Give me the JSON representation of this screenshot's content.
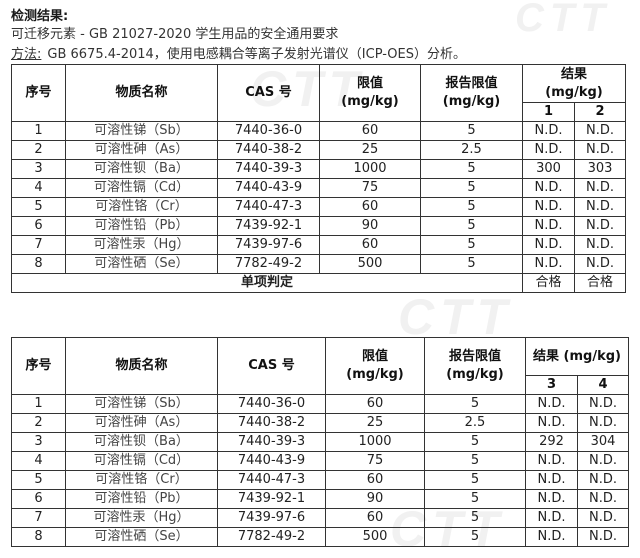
{
  "heading": "检测结果:",
  "standard_line": "可迁移元素 - GB 21027-2020 学生用品的安全通用要求",
  "method": {
    "label": "方法:",
    "text": "GB 6675.4-2014，使用电感耦合等离子发射光谱仪（ICP-OES）分析。"
  },
  "watermark_text": "CTT",
  "table_headers": {
    "no": "序号",
    "name": "物质名称",
    "cas": "CAS 号",
    "limit_line1": "限值",
    "limit_line2": "(mg/kg)",
    "report_limit_line1": "报告限值",
    "report_limit_line2": "(mg/kg)",
    "result_line1": "结果",
    "result_line2": "(mg/kg)",
    "result_combined": "结果 (mg/kg)"
  },
  "table1": {
    "sample_ids": [
      "1",
      "2"
    ],
    "rows": [
      {
        "no": "1",
        "name": "可溶性锑（Sb）",
        "cas": "7440-36-0",
        "limit": "60",
        "report_limit": "5",
        "r1": "N.D.",
        "r2": "N.D."
      },
      {
        "no": "2",
        "name": "可溶性砷（As）",
        "cas": "7440-38-2",
        "limit": "25",
        "report_limit": "2.5",
        "r1": "N.D.",
        "r2": "N.D."
      },
      {
        "no": "3",
        "name": "可溶性钡（Ba）",
        "cas": "7440-39-3",
        "limit": "1000",
        "report_limit": "5",
        "r1": "300",
        "r2": "303"
      },
      {
        "no": "4",
        "name": "可溶性镉（Cd）",
        "cas": "7440-43-9",
        "limit": "75",
        "report_limit": "5",
        "r1": "N.D.",
        "r2": "N.D."
      },
      {
        "no": "5",
        "name": "可溶性铬（Cr）",
        "cas": "7440-47-3",
        "limit": "60",
        "report_limit": "5",
        "r1": "N.D.",
        "r2": "N.D."
      },
      {
        "no": "6",
        "name": "可溶性铅（Pb）",
        "cas": "7439-92-1",
        "limit": "90",
        "report_limit": "5",
        "r1": "N.D.",
        "r2": "N.D."
      },
      {
        "no": "7",
        "name": "可溶性汞（Hg）",
        "cas": "7439-97-6",
        "limit": "60",
        "report_limit": "5",
        "r1": "N.D.",
        "r2": "N.D."
      },
      {
        "no": "8",
        "name": "可溶性硒（Se）",
        "cas": "7782-49-2",
        "limit": "500",
        "report_limit": "5",
        "r1": "N.D.",
        "r2": "N.D."
      }
    ],
    "verdict_label": "单项判定",
    "verdicts": [
      "合格",
      "合格"
    ]
  },
  "table2": {
    "sample_ids": [
      "3",
      "4"
    ],
    "rows": [
      {
        "no": "1",
        "name": "可溶性锑（Sb）",
        "cas": "7440-36-0",
        "limit": "60",
        "report_limit": "5",
        "r1": "N.D.",
        "r2": "N.D."
      },
      {
        "no": "2",
        "name": "可溶性砷（As）",
        "cas": "7440-38-2",
        "limit": "25",
        "report_limit": "2.5",
        "r1": "N.D.",
        "r2": "N.D."
      },
      {
        "no": "3",
        "name": "可溶性钡（Ba）",
        "cas": "7440-39-3",
        "limit": "1000",
        "report_limit": "5",
        "r1": "292",
        "r2": "304"
      },
      {
        "no": "4",
        "name": "可溶性镉（Cd）",
        "cas": "7440-43-9",
        "limit": "75",
        "report_limit": "5",
        "r1": "N.D.",
        "r2": "N.D."
      },
      {
        "no": "5",
        "name": "可溶性铬（Cr）",
        "cas": "7440-47-3",
        "limit": "60",
        "report_limit": "5",
        "r1": "N.D.",
        "r2": "N.D."
      },
      {
        "no": "6",
        "name": "可溶性铅（Pb）",
        "cas": "7439-92-1",
        "limit": "90",
        "report_limit": "5",
        "r1": "N.D.",
        "r2": "N.D."
      },
      {
        "no": "7",
        "name": "可溶性汞（Hg）",
        "cas": "7439-97-6",
        "limit": "60",
        "report_limit": "5",
        "r1": "N.D.",
        "r2": "N.D."
      },
      {
        "no": "8",
        "name": "可溶性硒（Se）",
        "cas": "7782-49-2",
        "limit": "500",
        "report_limit": "5",
        "r1": "N.D.",
        "r2": "N.D."
      }
    ]
  }
}
